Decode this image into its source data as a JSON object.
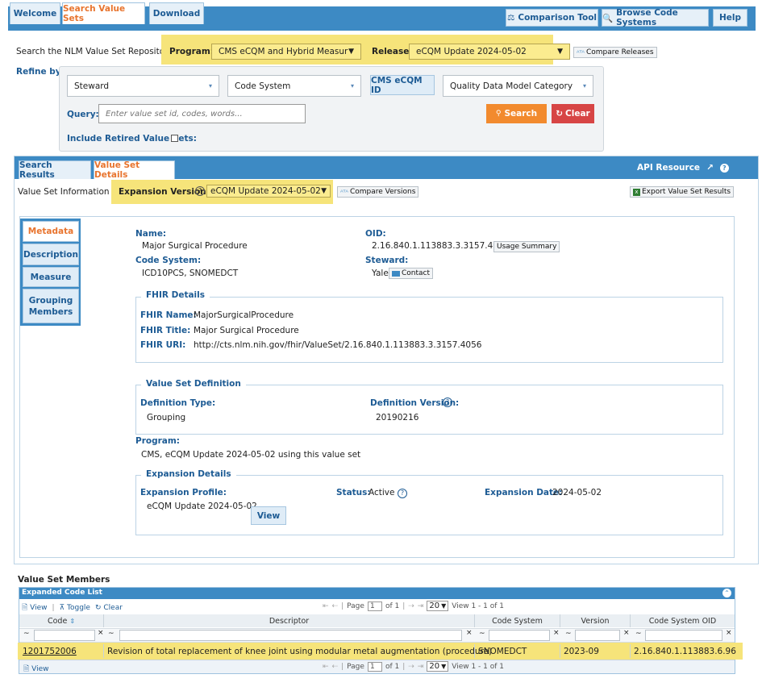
{
  "topnav": {
    "tabs": [
      "Welcome",
      "Search Value Sets",
      "Download"
    ],
    "comparison_tool": "Comparison Tool",
    "browse_code_systems": "Browse Code Systems",
    "help": "Help"
  },
  "search": {
    "intro": "Search the NLM Value Set Repository.",
    "program_label": "Program:",
    "program_value": "CMS eCQM and Hybrid Measur",
    "release_label": "Release:",
    "release_value": "eCQM Update 2024-05-02",
    "compare_releases": "Compare Releases",
    "refine_label": "Refine by:",
    "steward_placeholder": "Steward",
    "code_system_placeholder": "Code System",
    "cms_ecqm_id": "CMS eCQM ID",
    "qdm_category": "Quality Data Model Category",
    "query_label": "Query:",
    "query_placeholder": "Enter value set id, codes, words...",
    "search_button": "Search",
    "clear_button": "Clear",
    "include_retired": "Include Retired Value Sets:"
  },
  "results": {
    "tabs": [
      "Search Results",
      "Value Set Details"
    ],
    "api_resource": "API Resource",
    "info_label": "Value Set Information",
    "expansion_versions_label": "Expansion Versions:",
    "expansion_version_value": "eCQM Update 2024-05-02",
    "compare_versions": "Compare Versions",
    "export_results": "Export Value Set Results"
  },
  "details": {
    "side_tabs": [
      "Metadata",
      "Description",
      "Measure",
      "Grouping Members"
    ],
    "name_label": "Name:",
    "name_value": "Major Surgical Procedure",
    "oid_label": "OID:",
    "oid_value": "2.16.840.1.113883.3.3157.4056",
    "usage_summary": "Usage Summary",
    "code_system_label": "Code System:",
    "code_system_value": "ICD10PCS, SNOMEDCT",
    "steward_label": "Steward:",
    "steward_value": "Yale",
    "contact": "Contact",
    "fhir": {
      "legend": "FHIR Details",
      "name_label": "FHIR Name:",
      "name_value": "MajorSurgicalProcedure",
      "title_label": "FHIR Title:",
      "title_value": "Major Surgical Procedure",
      "uri_label": "FHIR URI:",
      "uri_value": "http://cts.nlm.nih.gov/fhir/ValueSet/2.16.840.1.113883.3.3157.4056"
    },
    "definition": {
      "legend": "Value Set Definition",
      "type_label": "Definition Type:",
      "type_value": "Grouping",
      "version_label": "Definition Version:",
      "version_value": "20190216"
    },
    "program_label": "Program:",
    "program_value": "CMS, eCQM Update 2024-05-02 using this value set",
    "expansion": {
      "legend": "Expansion Details",
      "profile_label": "Expansion Profile:",
      "profile_value": "eCQM Update 2024-05-02",
      "view": "View",
      "status_label": "Status:",
      "status_value": "Active",
      "date_label": "Expansion Date:",
      "date_value": "2024-05-02"
    }
  },
  "members": {
    "title": "Value Set Members",
    "grid_title": "Expanded Code List",
    "toolbar_view": "View",
    "toolbar_toggle": "Toggle",
    "toolbar_clear": "Clear",
    "pager": {
      "page_label": "Page",
      "page": "1",
      "of": "of 1",
      "rows": "20",
      "summary": "View 1 - 1 of 1",
      "footer_summary": "View 1 - 1 of 1"
    },
    "columns": [
      "Code",
      "Descriptor",
      "Code System",
      "Version",
      "Code System OID"
    ],
    "filter_op": "~",
    "rows": [
      {
        "code": "1201752006",
        "descriptor": "Revision of total replacement of knee joint using modular metal augmentation (procedure)",
        "code_system": "SNOMEDCT",
        "version": "2023-09",
        "oid": "2.16.840.1.113883.6.96"
      }
    ],
    "footer_view": "View"
  }
}
